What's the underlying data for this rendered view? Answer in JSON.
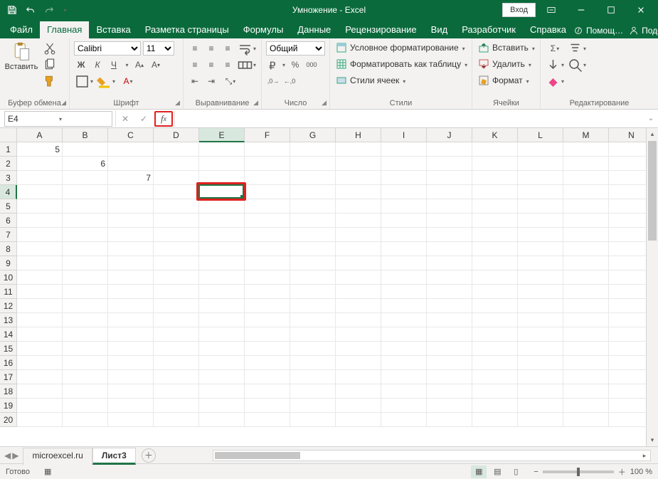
{
  "titlebar": {
    "title": "Умножение  -  Excel",
    "login": "Вход"
  },
  "tabs": [
    "Файл",
    "Главная",
    "Вставка",
    "Разметка страницы",
    "Формулы",
    "Данные",
    "Рецензирование",
    "Вид",
    "Разработчик",
    "Справка"
  ],
  "active_tab": 1,
  "help": {
    "assist": "Помощ…",
    "share": "Поделиться"
  },
  "ribbon": {
    "clipboard": {
      "paste": "Вставить",
      "label": "Буфер обмена"
    },
    "font": {
      "name": "Calibri",
      "size": "11",
      "label": "Шрифт"
    },
    "align": {
      "label": "Выравнивание"
    },
    "number": {
      "format": "Общий",
      "label": "Число"
    },
    "styles": {
      "cond": "Условное форматирование",
      "table": "Форматировать как таблицу",
      "cell": "Стили ячеек",
      "label": "Стили"
    },
    "cells": {
      "insert": "Вставить",
      "delete": "Удалить",
      "format": "Формат",
      "label": "Ячейки"
    },
    "editing": {
      "label": "Редактирование"
    }
  },
  "namebox": "E4",
  "columns": [
    "A",
    "B",
    "C",
    "D",
    "E",
    "F",
    "G",
    "H",
    "I",
    "J",
    "K",
    "L",
    "M",
    "N"
  ],
  "active_col": 4,
  "rows": 20,
  "active_row": 4,
  "cell_data": {
    "A1": "5",
    "B2": "6",
    "C3": "7"
  },
  "selected_cell": "E4",
  "sheets": {
    "nav_tabs": [
      "microexcel.ru",
      "Лист3"
    ],
    "active": 1
  },
  "status": {
    "ready": "Готово",
    "zoom": "100 %"
  }
}
